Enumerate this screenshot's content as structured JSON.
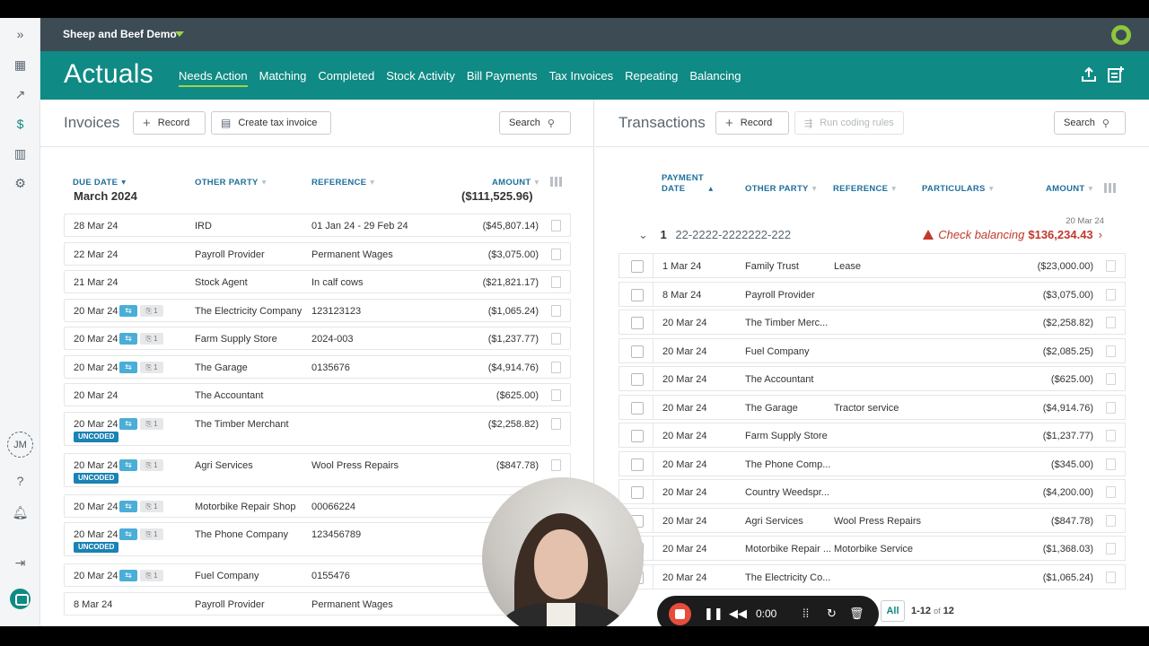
{
  "org": {
    "name": "Sheep and Beef Demo"
  },
  "header": {
    "title": "Actuals",
    "tabs": [
      "Needs Action",
      "Matching",
      "Completed",
      "Stock Activity",
      "Bill Payments",
      "Tax Invoices",
      "Repeating",
      "Balancing"
    ],
    "active_tab": "Needs Action"
  },
  "rail": {
    "avatar_initials": "JM",
    "icons": [
      "expand-icon",
      "dashboard-icon",
      "trend-icon",
      "dollar-icon",
      "reports-icon",
      "settings-icon",
      "help-icon",
      "notifications-icon",
      "logout-icon",
      "chat-icon"
    ]
  },
  "invoices": {
    "title": "Invoices",
    "record_label": "Record",
    "create_label": "Create tax invoice",
    "search_label": "Search",
    "columns": {
      "due_date": "DUE DATE",
      "other_party": "OTHER PARTY",
      "reference": "REFERENCE",
      "amount": "AMOUNT"
    },
    "group": {
      "label": "March 2024",
      "total": "($111,525.96)"
    },
    "sync_badge": "⇆",
    "attach_badge": "⎘ 1",
    "uncoded_label": "UNCODED",
    "rows": [
      {
        "date": "28 Mar 24",
        "party": "IRD",
        "ref": "01 Jan 24 - 29 Feb 24",
        "amount": "($45,807.14)",
        "badges": false,
        "uncoded": false
      },
      {
        "date": "22 Mar 24",
        "party": "Payroll Provider",
        "ref": "Permanent Wages",
        "amount": "($3,075.00)",
        "badges": false,
        "uncoded": false
      },
      {
        "date": "21 Mar 24",
        "party": "Stock Agent",
        "ref": "In calf cows",
        "amount": "($21,821.17)",
        "badges": false,
        "uncoded": false
      },
      {
        "date": "20 Mar 24",
        "party": "The Electricity Company",
        "ref": "123123123",
        "amount": "($1,065.24)",
        "badges": true,
        "uncoded": false
      },
      {
        "date": "20 Mar 24",
        "party": "Farm Supply Store",
        "ref": "2024-003",
        "amount": "($1,237.77)",
        "badges": true,
        "uncoded": false
      },
      {
        "date": "20 Mar 24",
        "party": "The Garage",
        "ref": "0135676",
        "amount": "($4,914.76)",
        "badges": true,
        "uncoded": false
      },
      {
        "date": "20 Mar 24",
        "party": "The Accountant",
        "ref": "",
        "amount": "($625.00)",
        "badges": false,
        "uncoded": false
      },
      {
        "date": "20 Mar 24",
        "party": "The Timber Merchant",
        "ref": "",
        "amount": "($2,258.82)",
        "badges": true,
        "uncoded": true
      },
      {
        "date": "20 Mar 24",
        "party": "Agri Services",
        "ref": "Wool Press Repairs",
        "amount": "($847.78)",
        "badges": true,
        "uncoded": true
      },
      {
        "date": "20 Mar 24",
        "party": "Motorbike Repair Shop",
        "ref": "00066224",
        "amount": "",
        "badges": true,
        "uncoded": false
      },
      {
        "date": "20 Mar 24",
        "party": "The Phone Company",
        "ref": "123456789",
        "amount": "",
        "badges": true,
        "uncoded": true
      },
      {
        "date": "20 Mar 24",
        "party": "Fuel Company",
        "ref": "0155476",
        "amount": "",
        "badges": true,
        "uncoded": false
      },
      {
        "date": "8 Mar 24",
        "party": "Payroll Provider",
        "ref": "Permanent Wages",
        "amount": "($3,0",
        "badges": false,
        "uncoded": false
      }
    ]
  },
  "transactions": {
    "title": "Transactions",
    "record_label": "Record",
    "run_rules_label": "Run coding rules",
    "search_label": "Search",
    "columns": {
      "payment": "PAYMENT",
      "date": "DATE",
      "other_party": "OTHER PARTY",
      "reference": "REFERENCE",
      "particulars": "PARTICULARS",
      "amount": "AMOUNT"
    },
    "account": {
      "count": "1",
      "number": "22-2222-2222222-222",
      "date": "20 Mar 24",
      "check_label": "Check balancing",
      "balance": "$136,234.43"
    },
    "rows": [
      {
        "date": "1 Mar 24",
        "party": "Family Trust",
        "ref": "Lease",
        "amount": "($23,000.00)"
      },
      {
        "date": "8 Mar 24",
        "party": "Payroll Provider",
        "ref": "",
        "amount": "($3,075.00)"
      },
      {
        "date": "20 Mar 24",
        "party": "The Timber Merc...",
        "ref": "",
        "amount": "($2,258.82)"
      },
      {
        "date": "20 Mar 24",
        "party": "Fuel Company",
        "ref": "",
        "amount": "($2,085.25)"
      },
      {
        "date": "20 Mar 24",
        "party": "The Accountant",
        "ref": "",
        "amount": "($625.00)"
      },
      {
        "date": "20 Mar 24",
        "party": "The Garage",
        "ref": "Tractor service",
        "amount": "($4,914.76)"
      },
      {
        "date": "20 Mar 24",
        "party": "Farm Supply Store",
        "ref": "",
        "amount": "($1,237.77)"
      },
      {
        "date": "20 Mar 24",
        "party": "The Phone Comp...",
        "ref": "",
        "amount": "($345.00)"
      },
      {
        "date": "20 Mar 24",
        "party": "Country Weedspr...",
        "ref": "",
        "amount": "($4,200.00)"
      },
      {
        "date": "20 Mar 24",
        "party": "Agri Services",
        "ref": "Wool Press Repairs",
        "amount": "($847.78)"
      },
      {
        "date": "20 Mar 24",
        "party": "Motorbike Repair ...",
        "ref": "Motorbike Service",
        "amount": "($1,368.03)"
      },
      {
        "date": "20 Mar 24",
        "party": "The Electricity Co...",
        "ref": "",
        "amount": "($1,065.24)"
      }
    ],
    "pager": {
      "all_label": "All",
      "range": "1-12",
      "of": "of",
      "total": "12"
    }
  },
  "recorder": {
    "time": "0:00"
  }
}
